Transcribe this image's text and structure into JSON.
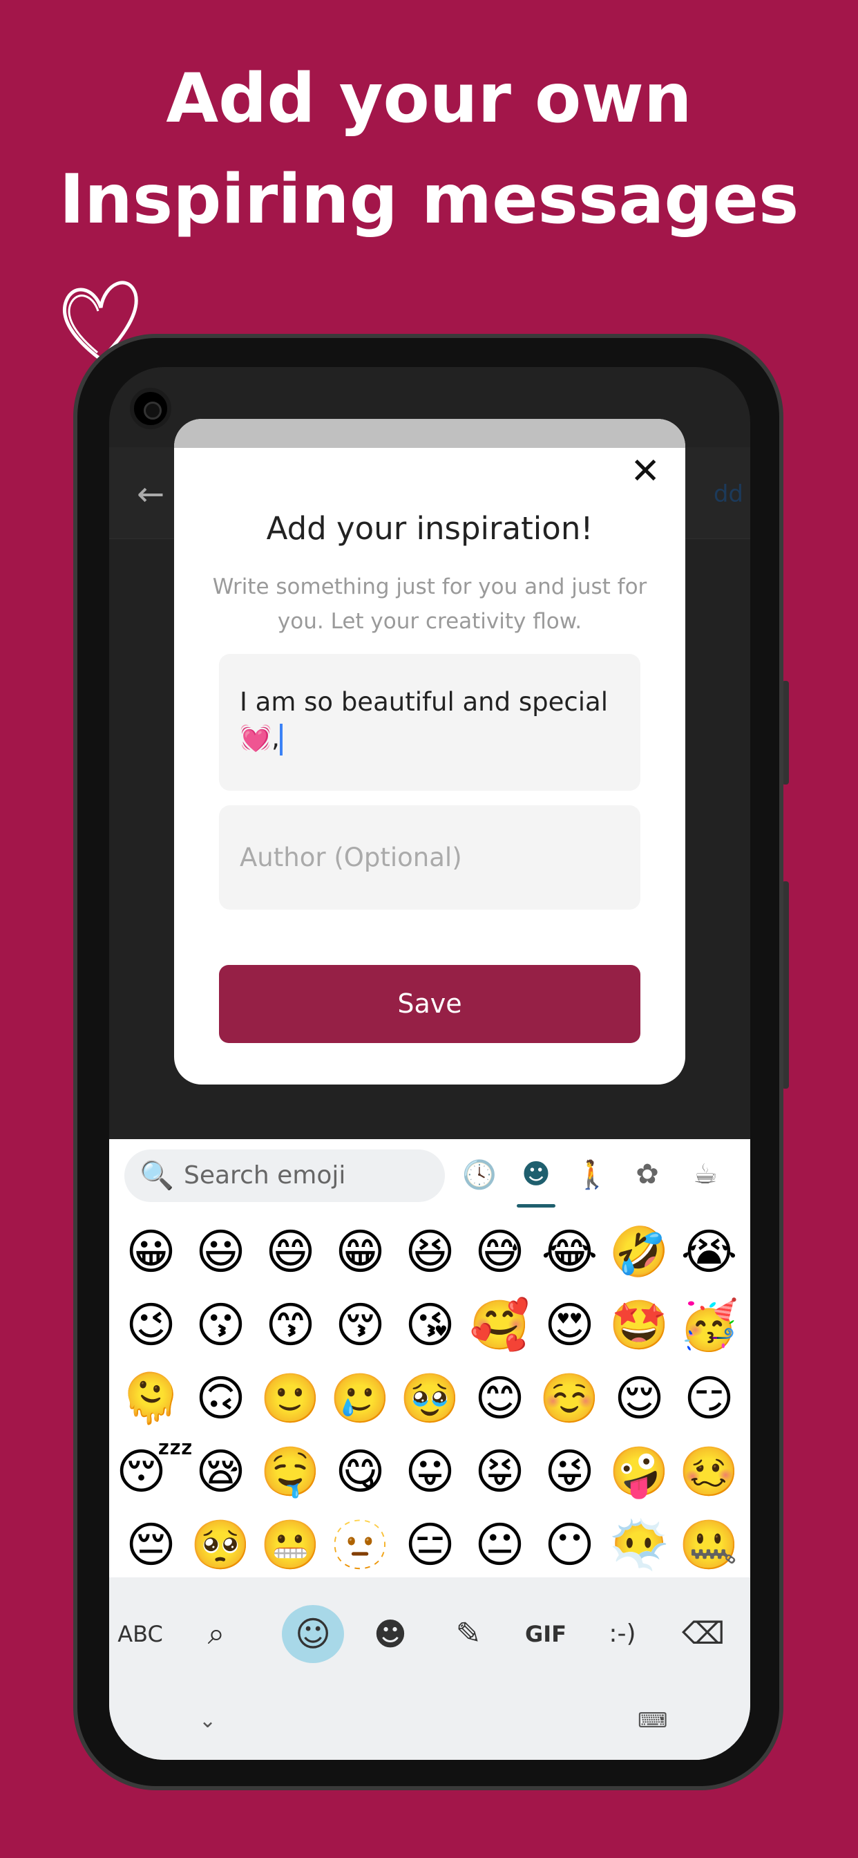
{
  "headline": {
    "line1": "Add your own",
    "line2": "Inspiring messages"
  },
  "colors": {
    "background": "#a3164a",
    "save_button": "#962046",
    "active_tab": "#1f5f6e"
  },
  "app": {
    "back_icon": "←",
    "add_link": "dd"
  },
  "dialog": {
    "close_icon": "✕",
    "title": "Add your inspiration!",
    "subtitle": "Write something just for you and just for you. Let your creativity flow.",
    "message_value": "I am so beautiful and special 💓,",
    "author_placeholder": "Author (Optional)",
    "save_label": "Save"
  },
  "keyboard": {
    "search_placeholder": "Search emoji",
    "search_icon": "🔍",
    "categories": [
      {
        "icon": "clock-icon",
        "glyph": "🕓"
      },
      {
        "icon": "smiley-icon",
        "glyph": "☻"
      },
      {
        "icon": "person-icon",
        "glyph": "🚶"
      },
      {
        "icon": "animals-icon",
        "glyph": "✿"
      },
      {
        "icon": "food-icon",
        "glyph": "☕"
      }
    ],
    "emojis": [
      "😀",
      "😃",
      "😄",
      "😁",
      "😆",
      "😅",
      "😂",
      "🤣",
      "😭",
      "😉",
      "😗",
      "😙",
      "😚",
      "😘",
      "🥰",
      "😍",
      "🤩",
      "🥳",
      "🫠",
      "🙃",
      "🙂",
      "🥲",
      "🥹",
      "😊",
      "☺️",
      "😌",
      "😏",
      "😴",
      "😪",
      "🤤",
      "😋",
      "😛",
      "😝",
      "😜",
      "🤪",
      "🥴",
      "😔",
      "🥺",
      "😬",
      "🫥",
      "😑",
      "😐",
      "😶",
      "😶‍🌫️",
      "🤐"
    ],
    "bottom_bar": {
      "abc": "ABC",
      "sticker_search": "⌕",
      "emoji": "☺",
      "emoji_kitchen": "☻",
      "sticker": "✎",
      "gif": "GIF",
      "emoticon": ":-)",
      "backspace": "⌫"
    },
    "nav": {
      "hide": "⌄",
      "keyboard": "⌨"
    }
  }
}
